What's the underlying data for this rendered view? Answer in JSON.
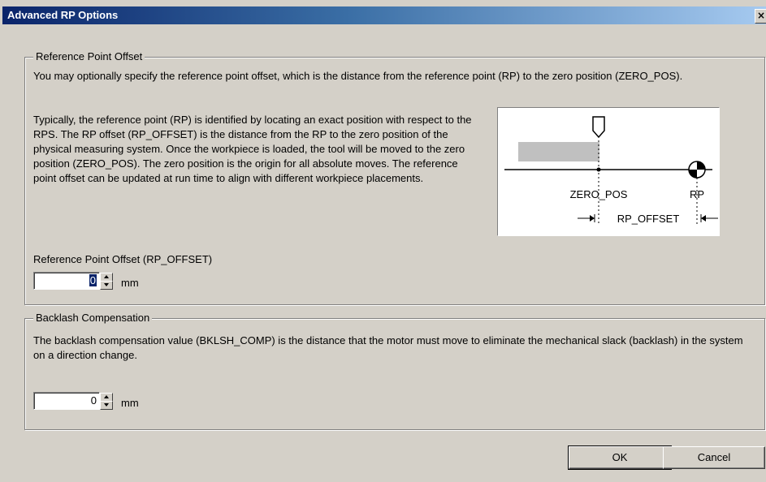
{
  "window": {
    "title": "Advanced RP Options",
    "close_glyph": "×"
  },
  "rp_group": {
    "legend": "Reference Point Offset",
    "intro": "You may optionally specify the reference point offset, which is the distance from the reference point (RP) to the zero position (ZERO_POS).",
    "description": "Typically, the reference point (RP) is identified by locating an exact position with respect to the RPS. The RP offset (RP_OFFSET) is the distance from the RP to the zero position of the physical measuring system. Once the workpiece is loaded, the tool will be moved to the zero position (ZERO_POS). The zero position is the origin for all absolute moves.  The reference point offset can be updated at run time to align with different workpiece placements.",
    "field_label": "Reference Point Offset (RP_OFFSET)",
    "value": "0",
    "unit": "mm",
    "diagram": {
      "zero_label": "ZERO_POS",
      "rp_label": "RP",
      "offset_label": "RP_OFFSET"
    }
  },
  "backlash_group": {
    "legend": "Backlash Compensation",
    "description": "The backlash compensation value (BKLSH_COMP) is the distance that the motor must move to eliminate the mechanical slack (backlash) in the system on a direction change.",
    "value": "0",
    "unit": "mm"
  },
  "buttons": {
    "ok": "OK",
    "cancel": "Cancel"
  },
  "icons": {
    "close": "close-icon",
    "spin_up": "spin-up-arrow-icon",
    "spin_down": "spin-down-arrow-icon",
    "tool": "tool-pointer-icon",
    "rp_marker": "reference-point-marker-icon"
  }
}
